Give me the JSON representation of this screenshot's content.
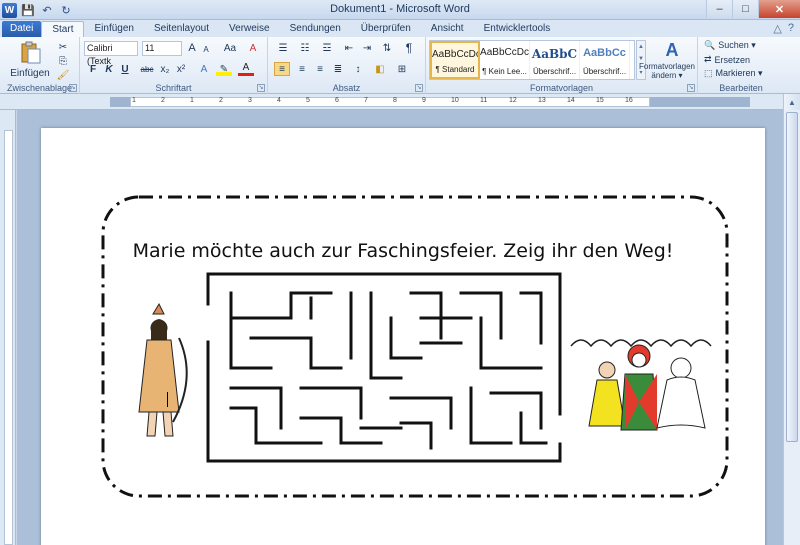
{
  "titlebar": {
    "title": "Dokument1 - Microsoft Word",
    "minimize": "–",
    "maximize": "□",
    "close": "✕"
  },
  "qat": {
    "save": "💾",
    "undo": "↶",
    "redo": "↻"
  },
  "tabs": [
    {
      "label": "Datei"
    },
    {
      "label": "Start"
    },
    {
      "label": "Einfügen"
    },
    {
      "label": "Seitenlayout"
    },
    {
      "label": "Verweise"
    },
    {
      "label": "Sendungen"
    },
    {
      "label": "Überprüfen"
    },
    {
      "label": "Ansicht"
    },
    {
      "label": "Entwicklertools"
    }
  ],
  "ribbon": {
    "clipboard": {
      "paste": "Einfügen",
      "label": "Zwischenablage"
    },
    "font": {
      "name": "Calibri (Textk",
      "size": "11",
      "label": "Schriftart",
      "bold": "F",
      "italic": "K",
      "underline": "U",
      "strike": "abc",
      "sub": "x₂",
      "sup": "x²",
      "grow": "A",
      "shrink": "A",
      "case": "Aa",
      "clear": "A"
    },
    "paragraph": {
      "label": "Absatz",
      "pilcrow": "¶"
    },
    "styles": {
      "label": "Formatvorlagen",
      "items": [
        {
          "sample": "AaBbCcDc",
          "name": "¶ Standard"
        },
        {
          "sample": "AaBbCcDc",
          "name": "¶ Kein Lee..."
        },
        {
          "sample": "AaBbC",
          "name": "Überschrif..."
        },
        {
          "sample": "AaBbCc",
          "name": "Überschrif..."
        }
      ],
      "change_line1": "Formatvorlagen",
      "change_line2": "ändern ▾"
    },
    "editing": {
      "label": "Bearbeiten",
      "find": "Suchen ▾",
      "replace": "Ersetzen",
      "select": "Markieren ▾"
    }
  },
  "ruler": {
    "numbers": [
      "1",
      "2",
      "1",
      "2",
      "3",
      "4",
      "5",
      "6",
      "7",
      "8",
      "9",
      "10",
      "11",
      "12",
      "13",
      "14",
      "15",
      "16"
    ]
  },
  "document": {
    "heading": "Marie möchte auch zur Faschingsfeier. Zeig ihr den Weg!"
  }
}
